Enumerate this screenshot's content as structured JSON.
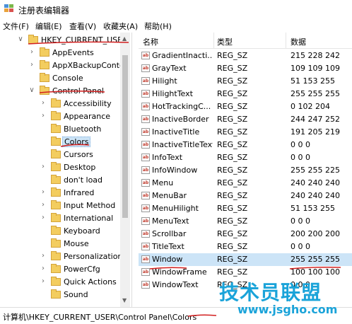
{
  "window": {
    "title": "注册表编辑器"
  },
  "menu": [
    "文件(F)",
    "编辑(E)",
    "查看(V)",
    "收藏夹(A)",
    "帮助(H)"
  ],
  "tree": [
    {
      "label": "HKEY_CURRENT_USER",
      "arrow": "∨"
    },
    {
      "label": "AppEvents",
      "arrow": "›"
    },
    {
      "label": "AppXBackupConter",
      "arrow": "›"
    },
    {
      "label": "Console",
      "arrow": ""
    },
    {
      "label": "Control Panel",
      "arrow": "∨"
    },
    {
      "label": "Accessibility",
      "arrow": "›"
    },
    {
      "label": "Appearance",
      "arrow": "›"
    },
    {
      "label": "Bluetooth",
      "arrow": ""
    },
    {
      "label": "Colors",
      "arrow": "",
      "selected": true
    },
    {
      "label": "Cursors",
      "arrow": ""
    },
    {
      "label": "Desktop",
      "arrow": "›"
    },
    {
      "label": "don't load",
      "arrow": ""
    },
    {
      "label": "Infrared",
      "arrow": "›"
    },
    {
      "label": "Input Method",
      "arrow": "›"
    },
    {
      "label": "International",
      "arrow": "›"
    },
    {
      "label": "Keyboard",
      "arrow": ""
    },
    {
      "label": "Mouse",
      "arrow": ""
    },
    {
      "label": "Personalization",
      "arrow": "›"
    },
    {
      "label": "PowerCfg",
      "arrow": "›"
    },
    {
      "label": "Quick Actions",
      "arrow": "›"
    },
    {
      "label": "Sound",
      "arrow": ""
    }
  ],
  "list": {
    "headers": {
      "name": "名称",
      "type": "类型",
      "data": "数据"
    },
    "rows": [
      {
        "name": "GradientInacti...",
        "type": "REG_SZ",
        "data": "215 228 242"
      },
      {
        "name": "GrayText",
        "type": "REG_SZ",
        "data": "109 109 109"
      },
      {
        "name": "Hilight",
        "type": "REG_SZ",
        "data": "51 153 255"
      },
      {
        "name": "HilightText",
        "type": "REG_SZ",
        "data": "255 255 255"
      },
      {
        "name": "HotTrackingC...",
        "type": "REG_SZ",
        "data": "0 102 204"
      },
      {
        "name": "InactiveBorder",
        "type": "REG_SZ",
        "data": "244 247 252"
      },
      {
        "name": "InactiveTitle",
        "type": "REG_SZ",
        "data": "191 205 219"
      },
      {
        "name": "InactiveTitleText",
        "type": "REG_SZ",
        "data": "0 0 0"
      },
      {
        "name": "InfoText",
        "type": "REG_SZ",
        "data": "0 0 0"
      },
      {
        "name": "InfoWindow",
        "type": "REG_SZ",
        "data": "255 255 225"
      },
      {
        "name": "Menu",
        "type": "REG_SZ",
        "data": "240 240 240"
      },
      {
        "name": "MenuBar",
        "type": "REG_SZ",
        "data": "240 240 240"
      },
      {
        "name": "MenuHilight",
        "type": "REG_SZ",
        "data": "51 153 255"
      },
      {
        "name": "MenuText",
        "type": "REG_SZ",
        "data": "0 0 0"
      },
      {
        "name": "Scrollbar",
        "type": "REG_SZ",
        "data": "200 200 200"
      },
      {
        "name": "TitleText",
        "type": "REG_SZ",
        "data": "0 0 0"
      },
      {
        "name": "Window",
        "type": "REG_SZ",
        "data": "255 255 255",
        "selected": true
      },
      {
        "name": "WindowFrame",
        "type": "REG_SZ",
        "data": "100 100 100"
      },
      {
        "name": "WindowText",
        "type": "REG_SZ",
        "data": "0 0 0"
      }
    ]
  },
  "status": {
    "path": "计算机\\HKEY_CURRENT_USER\\Control Panel\\Colors"
  },
  "watermark": {
    "title": "技术员联盟",
    "url": "www.jsgho.com"
  },
  "colors": {
    "folder": "#f3cd5f",
    "selection": "#cce4f7",
    "annotation": "#d21f1f",
    "watermark": "#1aa3d9"
  }
}
